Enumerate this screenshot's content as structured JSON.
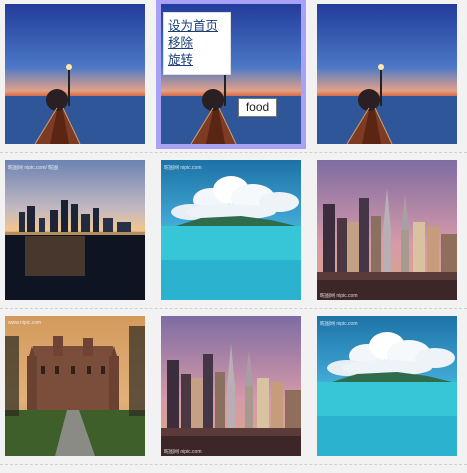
{
  "menu": {
    "items": [
      {
        "label": "设为首页"
      },
      {
        "label": "移除"
      },
      {
        "label": "旋转"
      }
    ]
  },
  "tooltip": {
    "text": "food"
  },
  "watermarks": {
    "row1": "昵图网 nipic.com",
    "row2": "昵图网 nipic.com/ 昵图",
    "row3": "www.nipic.com"
  },
  "colors": {
    "selection_border": "#a7a2f5",
    "background": "#f2f2f2"
  },
  "tiles": [
    {
      "name": "pier-sunset",
      "selected": false
    },
    {
      "name": "pier-sunset",
      "selected": true
    },
    {
      "name": "pier-sunset",
      "selected": false
    },
    {
      "name": "city-waterfront-sunset",
      "selected": false
    },
    {
      "name": "tropical-island-sky",
      "selected": false
    },
    {
      "name": "city-skyline-purple",
      "selected": false
    },
    {
      "name": "castle",
      "selected": false
    },
    {
      "name": "city-skyline-purple",
      "selected": false
    },
    {
      "name": "tropical-island-sky",
      "selected": false
    }
  ]
}
